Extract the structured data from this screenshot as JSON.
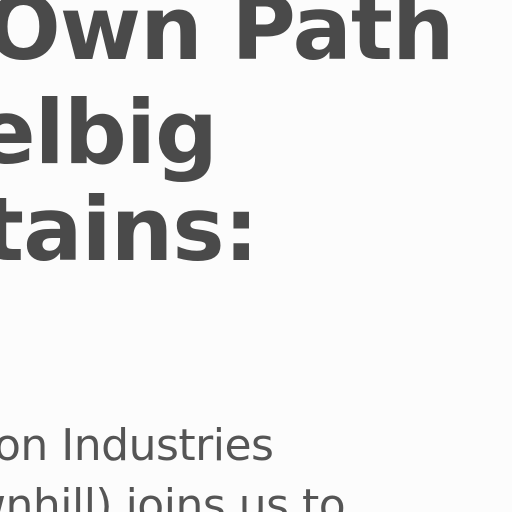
{
  "article": {
    "headline": [
      "Own Path",
      "elbig",
      "tains:"
    ],
    "body": [
      "on Industries",
      "wnhill) joins us to"
    ]
  },
  "colors": {
    "background": "#fcfcfc",
    "headline_text": "#4a4a4a",
    "body_text": "#555555"
  }
}
